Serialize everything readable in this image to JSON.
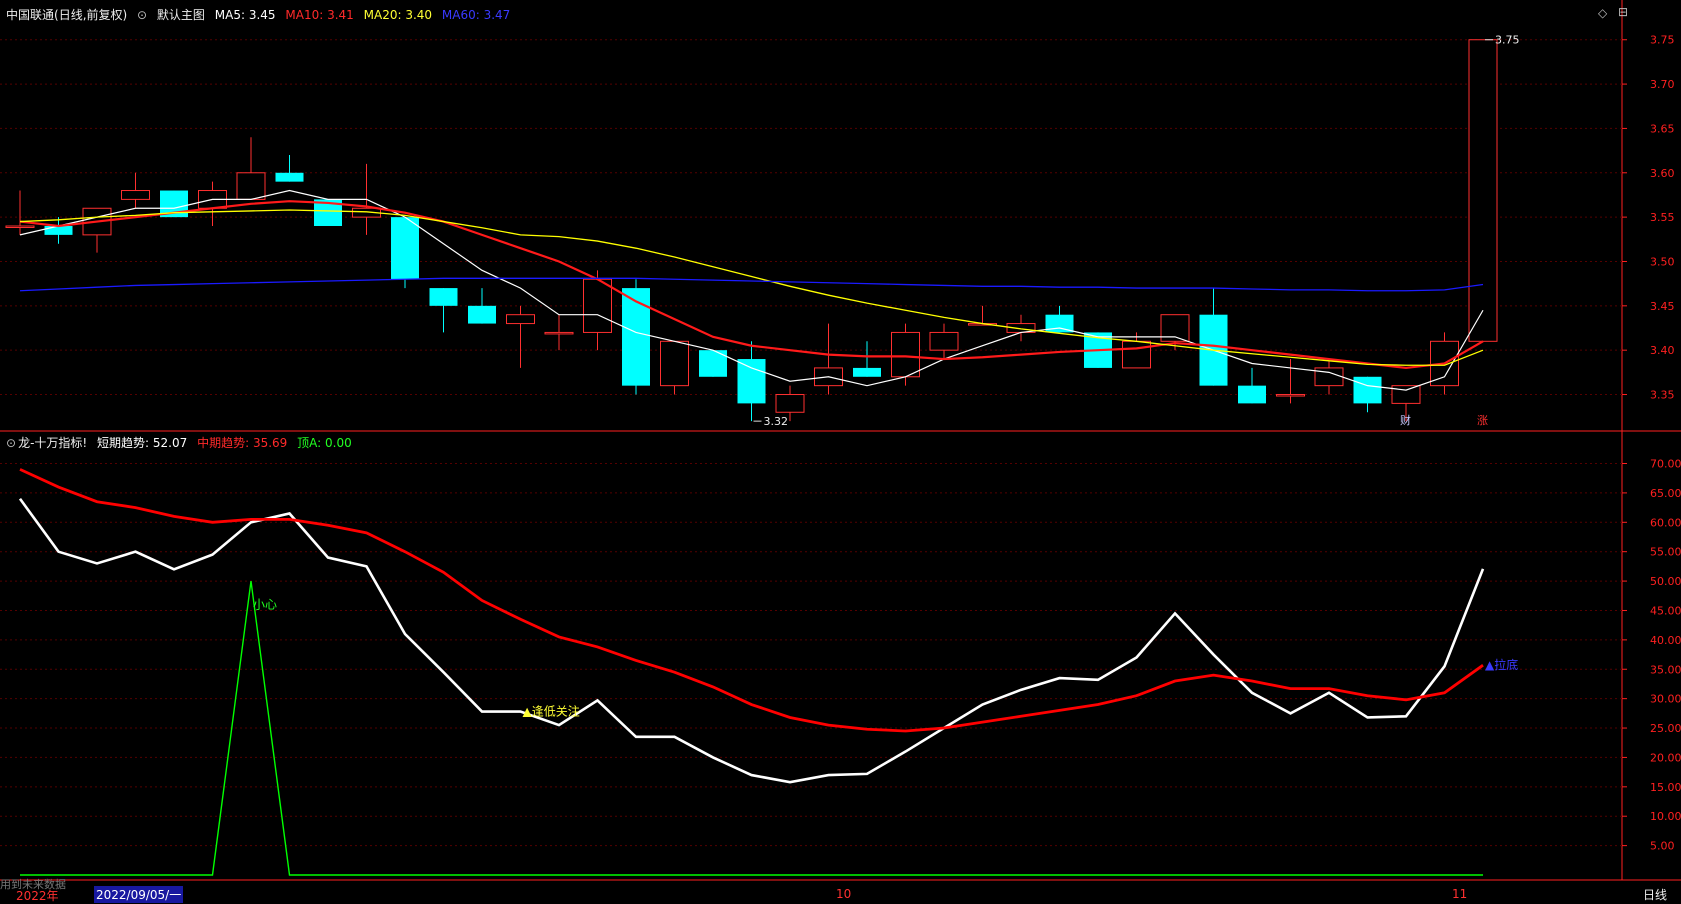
{
  "header": {
    "security": "中国联通",
    "period": "(日线,前复权)",
    "main_label": "默认主图",
    "ma5": "MA5: 3.45",
    "ma10": "MA10: 3.41",
    "ma20": "MA20: 3.40",
    "ma60": "MA60: 3.47"
  },
  "indicator_header": {
    "name": "龙-十万指标!",
    "short": "短期趋势: 52.07",
    "mid": "中期趋势: 35.69",
    "top": "顶A: 0.00"
  },
  "bottom_bar": {
    "year": "2022年",
    "date": "2022/09/05/一",
    "month_oct": "10",
    "month_nov": "11",
    "period_button": "日线",
    "note": "用到未来数据"
  },
  "colors": {
    "background": "#000000",
    "up": "#ff3030",
    "down": "#00ffff",
    "ma5": "#ffffff",
    "ma10": "#ff1a1a",
    "ma20": "#ffff00",
    "ma60": "#1a1aff",
    "grid": "#550000",
    "axis": "#ff2020",
    "short_trend": "#ffffff",
    "mid_trend": "#ff0000",
    "top_a": "#00ff00"
  },
  "chart_data": [
    {
      "type": "candlestick",
      "title": "中国联通 (日线,前复权)",
      "ylim": [
        3.31,
        3.77
      ],
      "yticks": [
        3.35,
        3.4,
        3.45,
        3.5,
        3.55,
        3.6,
        3.65,
        3.7,
        3.75
      ],
      "candles": [
        {
          "o": 3.54,
          "h": 3.58,
          "l": 3.53,
          "c": 3.54
        },
        {
          "o": 3.54,
          "h": 3.55,
          "l": 3.52,
          "c": 3.53
        },
        {
          "o": 3.53,
          "h": 3.56,
          "l": 3.51,
          "c": 3.56
        },
        {
          "o": 3.57,
          "h": 3.6,
          "l": 3.56,
          "c": 3.58
        },
        {
          "o": 3.58,
          "h": 3.58,
          "l": 3.55,
          "c": 3.55
        },
        {
          "o": 3.56,
          "h": 3.59,
          "l": 3.54,
          "c": 3.58
        },
        {
          "o": 3.57,
          "h": 3.64,
          "l": 3.57,
          "c": 3.6
        },
        {
          "o": 3.6,
          "h": 3.62,
          "l": 3.59,
          "c": 3.59
        },
        {
          "o": 3.57,
          "h": 3.57,
          "l": 3.54,
          "c": 3.54
        },
        {
          "o": 3.55,
          "h": 3.61,
          "l": 3.53,
          "c": 3.56
        },
        {
          "o": 3.55,
          "h": 3.55,
          "l": 3.47,
          "c": 3.48
        },
        {
          "o": 3.47,
          "h": 3.47,
          "l": 3.42,
          "c": 3.45
        },
        {
          "o": 3.45,
          "h": 3.47,
          "l": 3.43,
          "c": 3.43
        },
        {
          "o": 3.43,
          "h": 3.45,
          "l": 3.38,
          "c": 3.44
        },
        {
          "o": 3.42,
          "h": 3.44,
          "l": 3.4,
          "c": 3.42
        },
        {
          "o": 3.42,
          "h": 3.49,
          "l": 3.4,
          "c": 3.48
        },
        {
          "o": 3.47,
          "h": 3.48,
          "l": 3.35,
          "c": 3.36
        },
        {
          "o": 3.36,
          "h": 3.41,
          "l": 3.35,
          "c": 3.41
        },
        {
          "o": 3.4,
          "h": 3.4,
          "l": 3.37,
          "c": 3.37
        },
        {
          "o": 3.39,
          "h": 3.41,
          "l": 3.32,
          "c": 3.34
        },
        {
          "o": 3.33,
          "h": 3.36,
          "l": 3.32,
          "c": 3.35
        },
        {
          "o": 3.36,
          "h": 3.43,
          "l": 3.35,
          "c": 3.38
        },
        {
          "o": 3.38,
          "h": 3.41,
          "l": 3.37,
          "c": 3.37
        },
        {
          "o": 3.37,
          "h": 3.43,
          "l": 3.36,
          "c": 3.42
        },
        {
          "o": 3.4,
          "h": 3.43,
          "l": 3.39,
          "c": 3.42
        },
        {
          "o": 3.43,
          "h": 3.45,
          "l": 3.43,
          "c": 3.43
        },
        {
          "o": 3.42,
          "h": 3.44,
          "l": 3.41,
          "c": 3.43
        },
        {
          "o": 3.44,
          "h": 3.45,
          "l": 3.42,
          "c": 3.42
        },
        {
          "o": 3.42,
          "h": 3.42,
          "l": 3.38,
          "c": 3.38
        },
        {
          "o": 3.38,
          "h": 3.42,
          "l": 3.38,
          "c": 3.41
        },
        {
          "o": 3.41,
          "h": 3.44,
          "l": 3.4,
          "c": 3.44
        },
        {
          "o": 3.44,
          "h": 3.47,
          "l": 3.36,
          "c": 3.36
        },
        {
          "o": 3.36,
          "h": 3.38,
          "l": 3.34,
          "c": 3.34
        },
        {
          "o": 3.35,
          "h": 3.39,
          "l": 3.34,
          "c": 3.35
        },
        {
          "o": 3.36,
          "h": 3.39,
          "l": 3.35,
          "c": 3.38
        },
        {
          "o": 3.37,
          "h": 3.37,
          "l": 3.33,
          "c": 3.34
        },
        {
          "o": 3.34,
          "h": 3.36,
          "l": 3.32,
          "c": 3.36
        },
        {
          "o": 3.36,
          "h": 3.42,
          "l": 3.35,
          "c": 3.41
        },
        {
          "o": 3.41,
          "h": 3.75,
          "l": 3.41,
          "c": 3.75
        }
      ],
      "series": [
        {
          "name": "MA5",
          "values": [
            3.53,
            3.54,
            3.55,
            3.56,
            3.56,
            3.57,
            3.57,
            3.58,
            3.57,
            3.57,
            3.55,
            3.52,
            3.49,
            3.47,
            3.44,
            3.44,
            3.42,
            3.41,
            3.4,
            3.38,
            3.365,
            3.37,
            3.36,
            3.37,
            3.39,
            3.405,
            3.42,
            3.425,
            3.415,
            3.415,
            3.415,
            3.4,
            3.385,
            3.38,
            3.375,
            3.36,
            3.355,
            3.37,
            3.445
          ]
        },
        {
          "name": "MA10",
          "values": [
            3.545,
            3.54,
            3.545,
            3.55,
            3.555,
            3.56,
            3.565,
            3.568,
            3.566,
            3.562,
            3.555,
            3.545,
            3.53,
            3.515,
            3.5,
            3.48,
            3.455,
            3.435,
            3.415,
            3.405,
            3.4,
            3.395,
            3.393,
            3.393,
            3.39,
            3.392,
            3.395,
            3.398,
            3.4,
            3.402,
            3.408,
            3.405,
            3.4,
            3.395,
            3.39,
            3.385,
            3.38,
            3.385,
            3.41
          ]
        },
        {
          "name": "MA20",
          "values": [
            3.545,
            3.547,
            3.55,
            3.552,
            3.555,
            3.556,
            3.557,
            3.558,
            3.557,
            3.556,
            3.552,
            3.545,
            3.538,
            3.53,
            3.528,
            3.523,
            3.515,
            3.505,
            3.494,
            3.483,
            3.472,
            3.462,
            3.453,
            3.445,
            3.437,
            3.43,
            3.424,
            3.419,
            3.414,
            3.41,
            3.405,
            3.4,
            3.396,
            3.392,
            3.388,
            3.384,
            3.383,
            3.383,
            3.4
          ]
        },
        {
          "name": "MA60",
          "values": [
            3.467,
            3.469,
            3.471,
            3.473,
            3.474,
            3.475,
            3.476,
            3.477,
            3.478,
            3.479,
            3.48,
            3.481,
            3.481,
            3.481,
            3.481,
            3.481,
            3.481,
            3.48,
            3.479,
            3.478,
            3.477,
            3.476,
            3.475,
            3.474,
            3.473,
            3.472,
            3.472,
            3.471,
            3.471,
            3.47,
            3.47,
            3.47,
            3.469,
            3.468,
            3.468,
            3.467,
            3.467,
            3.468,
            3.474
          ]
        }
      ],
      "annotations": [
        {
          "label": "3.75",
          "index": 38,
          "value": 3.75
        },
        {
          "label": "3.32",
          "index": 19,
          "value": 3.32
        },
        {
          "label": "财",
          "index": 36
        },
        {
          "label": "涨",
          "index": 38
        }
      ]
    },
    {
      "type": "line",
      "title": "龙-十万指标!",
      "ylim": [
        0,
        74
      ],
      "yticks": [
        5,
        10,
        15,
        20,
        25,
        30,
        35,
        40,
        45,
        50,
        55,
        60,
        65,
        70
      ],
      "series": [
        {
          "name": "短期趋势",
          "values": [
            64,
            55,
            53,
            55,
            52,
            54.5,
            60,
            61.5,
            54,
            52.5,
            41,
            34.5,
            27.8,
            27.8,
            25.5,
            29.7,
            23.5,
            23.5,
            20,
            17,
            15.8,
            17,
            17.2,
            21,
            25,
            29,
            31.5,
            33.5,
            33.2,
            37,
            44.5,
            37.5,
            31,
            27.5,
            31,
            26.8,
            27,
            35.5,
            52.07
          ]
        },
        {
          "name": "中期趋势",
          "values": [
            69,
            66,
            63.5,
            62.5,
            61,
            60,
            60.5,
            60.5,
            59.5,
            58.2,
            55,
            51.5,
            46.7,
            43.5,
            40.5,
            38.8,
            36.5,
            34.5,
            32,
            29,
            26.8,
            25.5,
            24.8,
            24.5,
            25,
            26,
            27,
            28,
            29,
            30.5,
            33,
            34,
            33,
            31.7,
            31.7,
            30.5,
            29.8,
            31,
            35.69
          ]
        },
        {
          "name": "顶A",
          "values": [
            0,
            0,
            0,
            0,
            0,
            0,
            50,
            0,
            0,
            0,
            0,
            0,
            0,
            0,
            0,
            0,
            0,
            0,
            0,
            0,
            0,
            0,
            0,
            0,
            0,
            0,
            0,
            0,
            0,
            0,
            0,
            0,
            0,
            0,
            0,
            0,
            0,
            0,
            0
          ]
        }
      ],
      "annotations": [
        {
          "label": "小心",
          "index": 6,
          "value": 46
        },
        {
          "label": "▲逢低关注",
          "index": 13,
          "value": 27.8
        },
        {
          "label": "▲拉底",
          "index": 38,
          "value": 35.69
        }
      ]
    }
  ]
}
